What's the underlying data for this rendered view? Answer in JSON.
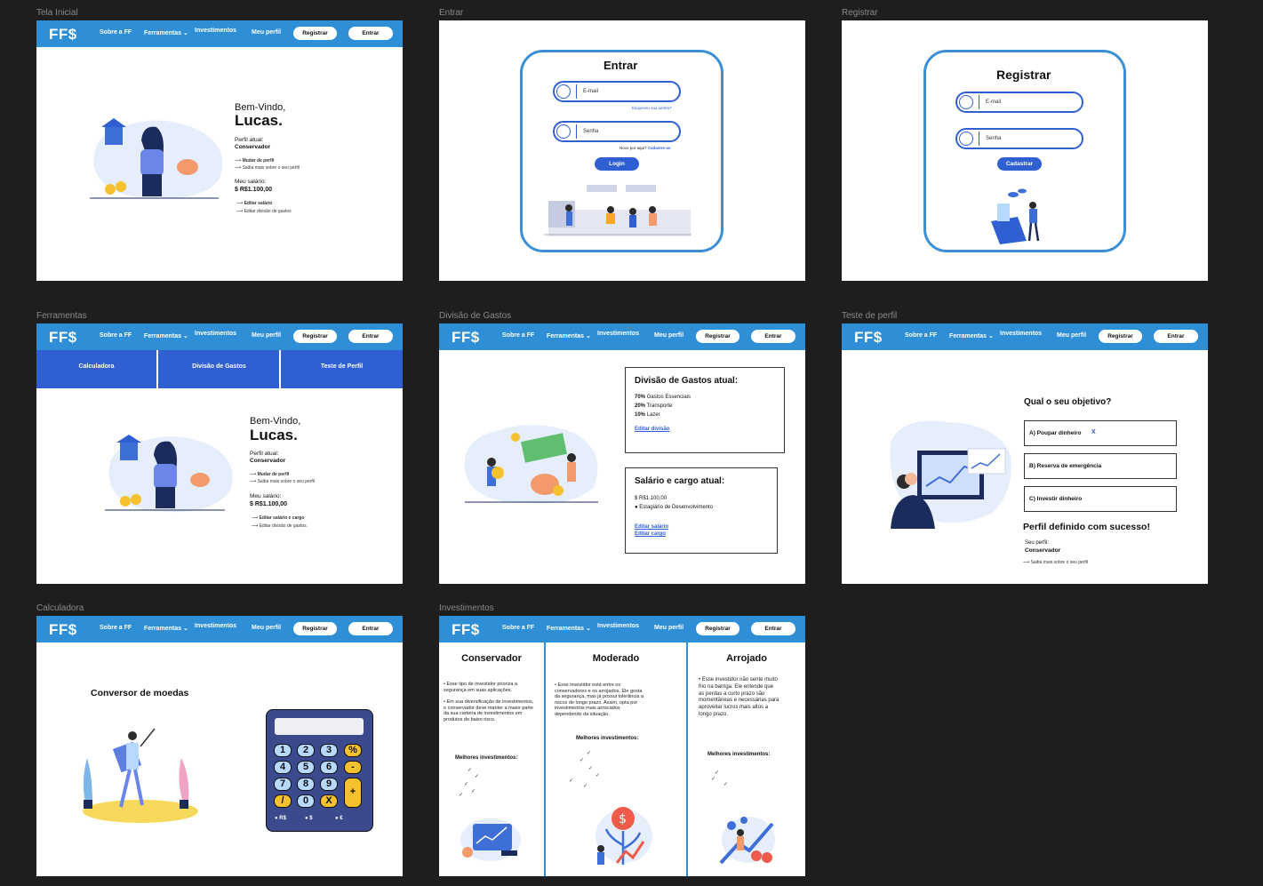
{
  "frame_labels": {
    "tela_inicial": "Tela Inicial",
    "entrar": "Entrar",
    "registrar": "Registrar",
    "ferramentas": "Ferramentas",
    "divisao": "Divisão de Gastos",
    "teste": "Teste de perfil",
    "calculadora": "Calculadora",
    "investimentos": "Investimentos"
  },
  "nav": {
    "logo": "FF$",
    "sobre": "Sobre a FF",
    "ferramentas": "Ferramentas",
    "investimentos": "Investimentos",
    "perfil": "Meu perfil",
    "registrar": "Registrar",
    "entrar": "Entrar",
    "color": "#2f8fd6"
  },
  "home": {
    "welcome": "Bem-Vindo,",
    "name": "Lucas.",
    "perfil_label": "Perfil atual:",
    "perfil_value": "Conservador",
    "mudar": "Mudar de perfil",
    "saiba": "Saiba mais sobre o seu perfil",
    "salario_label": "Meu salário:",
    "salario_value": "R$1.100,00",
    "editar_salario": "Editar salário",
    "editar_divisao": "Editar divisão de gastos",
    "editar_salario_cargo": "Editar salário e cargo",
    "editar_divisao_alt": "Editar divisão de gastos."
  },
  "login": {
    "title": "Entrar",
    "email_ph": "E-mail",
    "forgot": "Esqueceu sua senha?",
    "senha_ph": "Senha",
    "novo": "Novo por aqui?",
    "cadastre": "Cadastre-se",
    "button": "Login"
  },
  "register": {
    "title": "Registrar",
    "email_ph": "E-mail",
    "senha_ph": "Senha",
    "button": "Cadastrar"
  },
  "tools_tabs": [
    "Calculadora",
    "Divisão de Gastos",
    "Teste de Perfil"
  ],
  "division": {
    "title": "Divisão de Gastos atual:",
    "items": [
      {
        "pct": "70%",
        "label": "Gastos Essenciais"
      },
      {
        "pct": "20%",
        "label": "Transporte"
      },
      {
        "pct": "10%",
        "label": "Lazer"
      }
    ],
    "edit": "Editar divisão",
    "salary_title": "Salário e cargo atual:",
    "salary": "R$1.100,00",
    "cargo": "Estagiário de Desenvolvimento",
    "edit_salary": "Editar salário",
    "edit_cargo": "Editar cargo"
  },
  "test": {
    "question": "Qual o seu objetivo?",
    "options": [
      "A) Poupar dinheiro",
      "B) Reserva de emergência",
      "C) Investir dinheiro"
    ],
    "selected_mark": "X",
    "success": "Perfil definido com sucesso!",
    "seu_perfil": "Seu perfil:",
    "perfil_value": "Conservador",
    "saiba": "Saiba mais sobre o seu perfil"
  },
  "calculator": {
    "title": "Conversor de moedas",
    "keys": [
      "1",
      "2",
      "3",
      "%",
      "4",
      "5",
      "6",
      "-",
      "7",
      "8",
      "9",
      "+",
      "/",
      "0",
      "X"
    ],
    "currencies": [
      "R$",
      "$",
      "€"
    ]
  },
  "investments": {
    "columns": [
      {
        "title": "Conservador",
        "bullets": [
          "Esse tipo de investidor prioriza a segurança em suas aplicações.",
          "Em sua diversificação de investimentos, o conservador deve manter a maior parte da sua carteira de investimentos em produtos de baixo risco."
        ],
        "best": "Melhores investimentos:"
      },
      {
        "title": "Moderado",
        "bullets": [
          "Esse investidor está entre os conservadores e os arrojados. Ele gosta da segurança, mas já possui tolerância a riscos de longo prazo. Assim, opta por investimentos mais arriscados dependendo da situação."
        ],
        "best": "Melhores investimentos:"
      },
      {
        "title": "Arrojado",
        "bullets": [
          "Esse investidor não sente muito frio na barriga. Ele entende que as perdas a curto prazo são momentâneas e necessárias para aproveitar lucros mais altos a longo prazo."
        ],
        "best": "Melhores investimentos:"
      }
    ]
  }
}
